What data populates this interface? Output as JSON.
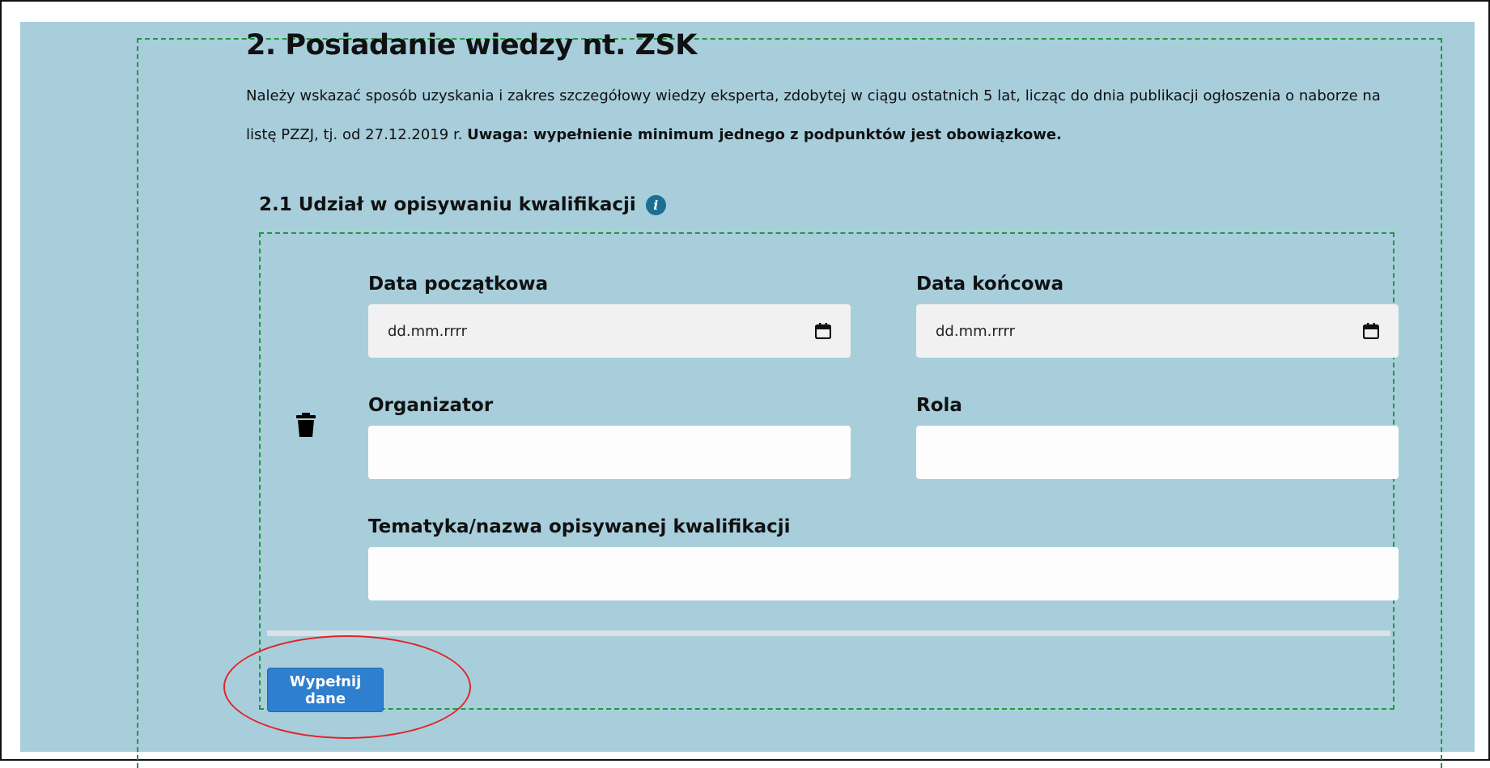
{
  "section": {
    "title": "2. Posiadanie wiedzy nt. ZSK",
    "description_plain": "Należy wskazać sposób uzyskania i zakres szczegółowy wiedzy eksperta, zdobytej w ciągu ostatnich 5 lat, licząc do dnia publikacji ogłoszenia o naborze na listę PZZJ, tj. od 27.12.2019 r. ",
    "description_bold": "Uwaga: wypełnienie minimum jednego z podpunktów jest obowiązkowe."
  },
  "subsection": {
    "title": "2.1 Udział w opisywaniu kwalifikacji",
    "info_icon": "info-icon"
  },
  "form": {
    "start_date": {
      "label": "Data początkowa",
      "placeholder": "dd.mm.rrrr"
    },
    "end_date": {
      "label": "Data końcowa",
      "placeholder": "dd.mm.rrrr"
    },
    "organizer": {
      "label": "Organizator",
      "value": ""
    },
    "role": {
      "label": "Rola",
      "value": ""
    },
    "topic": {
      "label": "Tematyka/nazwa opisywanej kwalifikacji",
      "value": ""
    },
    "delete_icon": "trash-icon"
  },
  "actions": {
    "fill_label": "Wypełnij dane"
  },
  "colors": {
    "panel_bg": "#a8cedc",
    "dashed_border": "#1e9a3a",
    "button_bg": "#2f7fd1",
    "highlight_circle": "#e0242a"
  }
}
